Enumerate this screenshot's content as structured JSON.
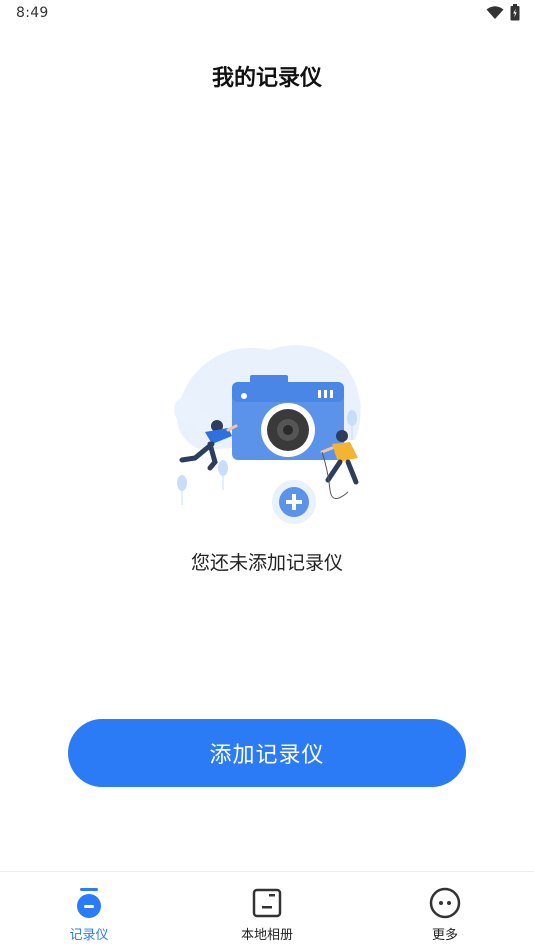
{
  "status_bar": {
    "time": "8:49",
    "icons": [
      "wifi-icon",
      "battery-icon"
    ]
  },
  "header": {
    "title": "我的记录仪"
  },
  "empty_state": {
    "illustration": "camera-add-illustration",
    "message": "您还未添加记录仪"
  },
  "primary_action": {
    "label": "添加记录仪"
  },
  "bottom_nav": {
    "items": [
      {
        "label": "记录仪",
        "icon": "recorder-icon",
        "active": true
      },
      {
        "label": "本地相册",
        "icon": "album-icon",
        "active": false
      },
      {
        "label": "更多",
        "icon": "more-icon",
        "active": false
      }
    ]
  },
  "colors": {
    "accent": "#2b7bf6",
    "background": "#ffffff",
    "illustration_bg": "#e8f1fc"
  }
}
